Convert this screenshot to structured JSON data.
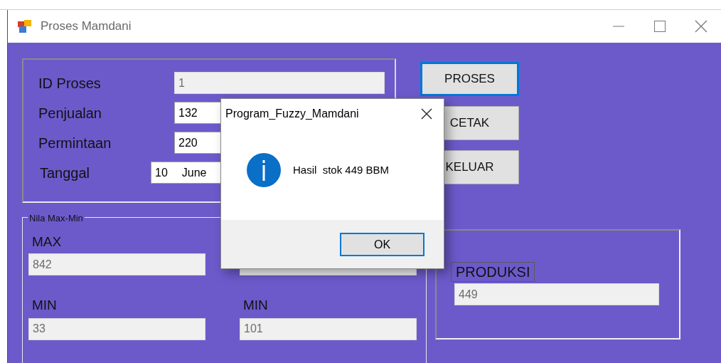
{
  "window": {
    "title": "Proses Mamdani"
  },
  "input_group": {
    "fields": [
      {
        "label": "ID Proses",
        "value": "1",
        "readonly": true,
        "kind": "text"
      },
      {
        "label": "Penjualan",
        "value": "132",
        "readonly": false,
        "kind": "text"
      },
      {
        "label": "Permintaan",
        "value": "220",
        "readonly": false,
        "kind": "text"
      },
      {
        "label": "Tanggal",
        "value": "10",
        "month": "June",
        "readonly": false,
        "kind": "date"
      }
    ]
  },
  "buttons": [
    {
      "label": "PROSES",
      "focused": true
    },
    {
      "label": "CETAK",
      "focused": false
    },
    {
      "label": "KELUAR",
      "focused": false
    }
  ],
  "maxmin_group": {
    "title": "Nila Max-Min",
    "columns": [
      {
        "max_label": "MAX",
        "max_value": "842",
        "min_label": "MIN",
        "min_value": "33"
      },
      {
        "min_label": "MIN",
        "min_value": "101"
      }
    ]
  },
  "produksi_group": {
    "label": "PRODUKSI",
    "value": "449"
  },
  "dialog": {
    "title": "Program_Fuzzy_Mamdani",
    "message": "Hasil  stok 449 BBM",
    "button": "OK"
  }
}
